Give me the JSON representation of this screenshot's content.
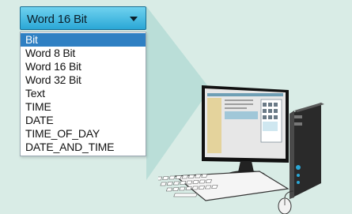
{
  "dropdown": {
    "value": "Word 16 Bit",
    "icon": "chevron-down-icon"
  },
  "options": [
    "Bit",
    "Word 8 Bit",
    "Word 16 Bit",
    "Word 32 Bit",
    "Text",
    "TIME",
    "DATE",
    "TIME_OF_DAY",
    "DATE_AND_TIME"
  ],
  "selected_option": "Bit",
  "colors": {
    "background": "#d9ece6",
    "beam": "#b8ddd7",
    "dropdown_accent": "#2aa7d6",
    "selection": "#2f80c3"
  },
  "illustration": {
    "icons": [
      "monitor-icon",
      "computer-tower-icon",
      "keyboard-icon",
      "mouse-icon"
    ]
  }
}
